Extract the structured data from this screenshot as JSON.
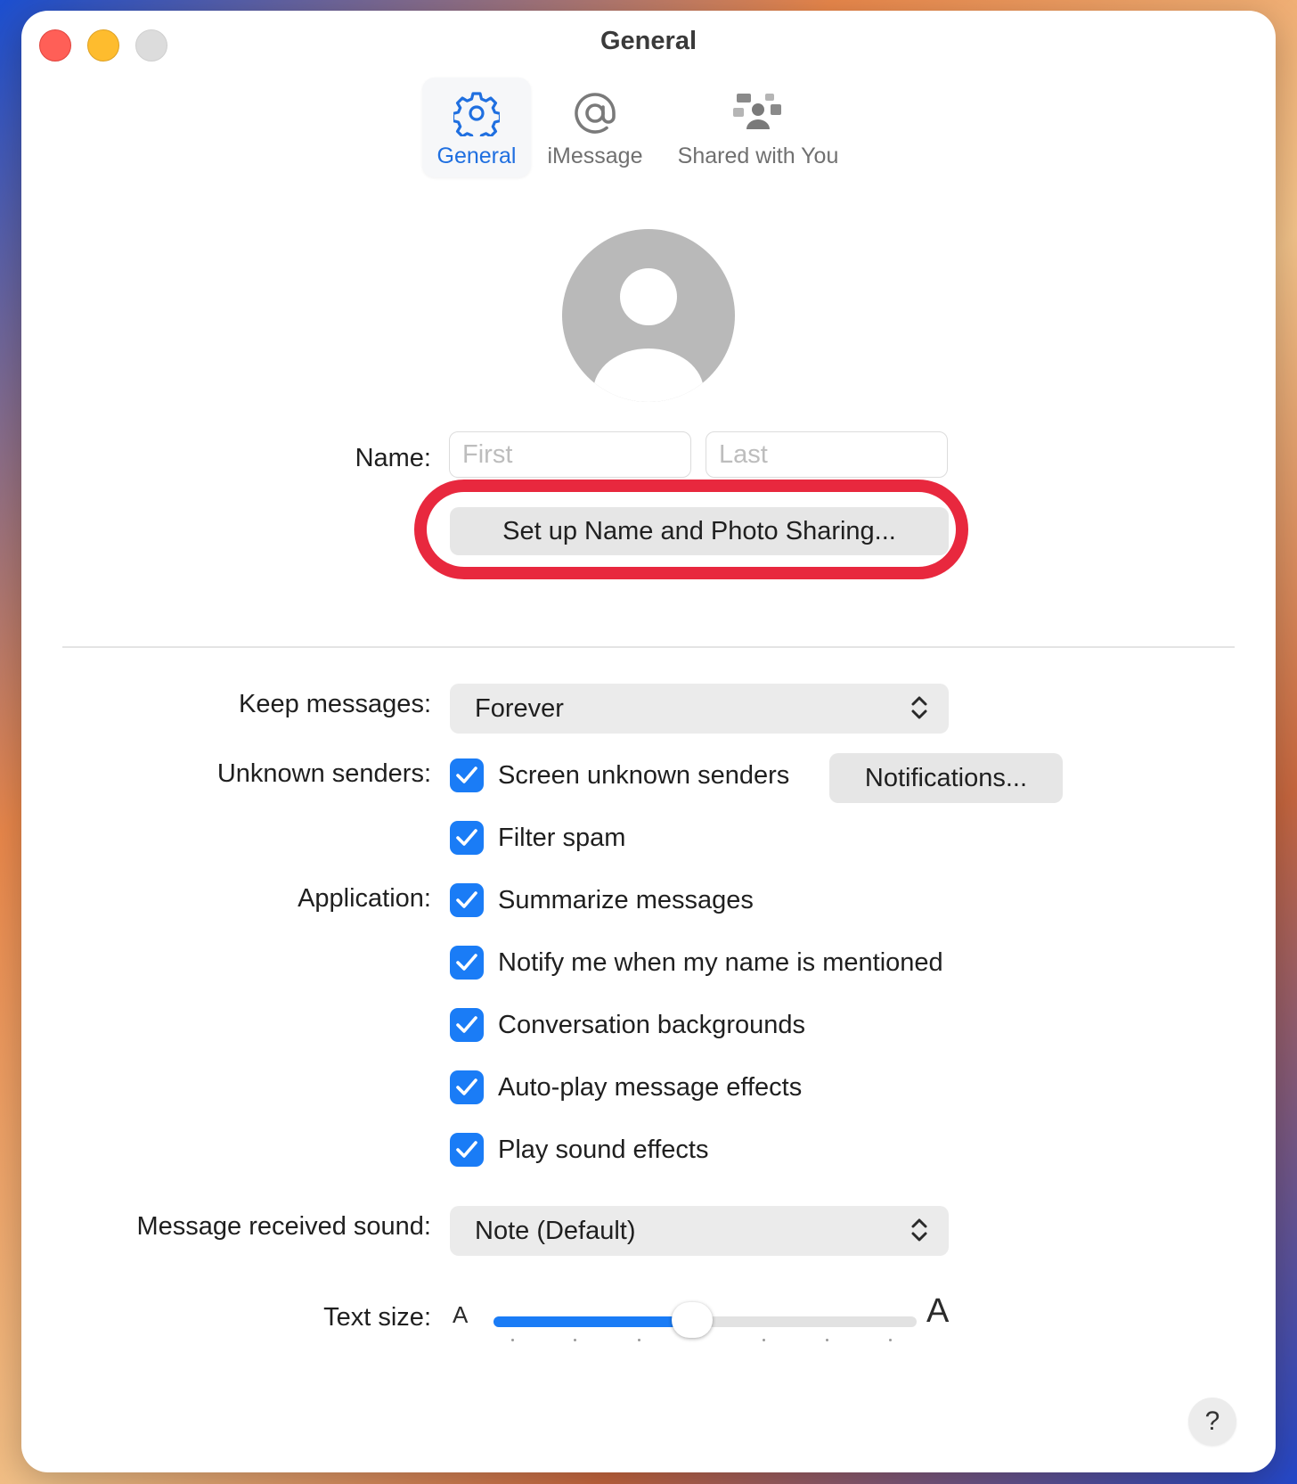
{
  "window": {
    "title": "General"
  },
  "tabs": [
    {
      "label": "General",
      "icon": "gear-icon",
      "active": true
    },
    {
      "label": "iMessage",
      "icon": "at-sign-icon",
      "active": false
    },
    {
      "label": "Shared with You",
      "icon": "shared-with-you-icon",
      "active": false
    }
  ],
  "profile": {
    "name_label": "Name:",
    "first_placeholder": "First",
    "last_placeholder": "Last",
    "share_button": "Set up Name and Photo Sharing..."
  },
  "settings": {
    "keep_messages": {
      "label": "Keep messages:",
      "value": "Forever"
    },
    "unknown_senders": {
      "label": "Unknown senders:",
      "screen_label": "Screen unknown senders",
      "screen_checked": true,
      "notifications_button": "Notifications...",
      "filter_label": "Filter spam",
      "filter_checked": true
    },
    "application": {
      "label": "Application:",
      "options": [
        {
          "label": "Summarize messages",
          "checked": true
        },
        {
          "label": "Notify me when my name is mentioned",
          "checked": true
        },
        {
          "label": "Conversation backgrounds",
          "checked": true
        },
        {
          "label": "Auto-play message effects",
          "checked": true
        },
        {
          "label": "Play sound effects",
          "checked": true
        }
      ]
    },
    "received_sound": {
      "label": "Message received sound:",
      "value": "Note (Default)"
    },
    "text_size": {
      "label": "Text size:",
      "small_glyph": "A",
      "large_glyph": "A",
      "level": 0.47
    }
  },
  "help_button": "?",
  "colors": {
    "accent": "#1a7cf6",
    "highlight_ring": "#e8283e"
  }
}
